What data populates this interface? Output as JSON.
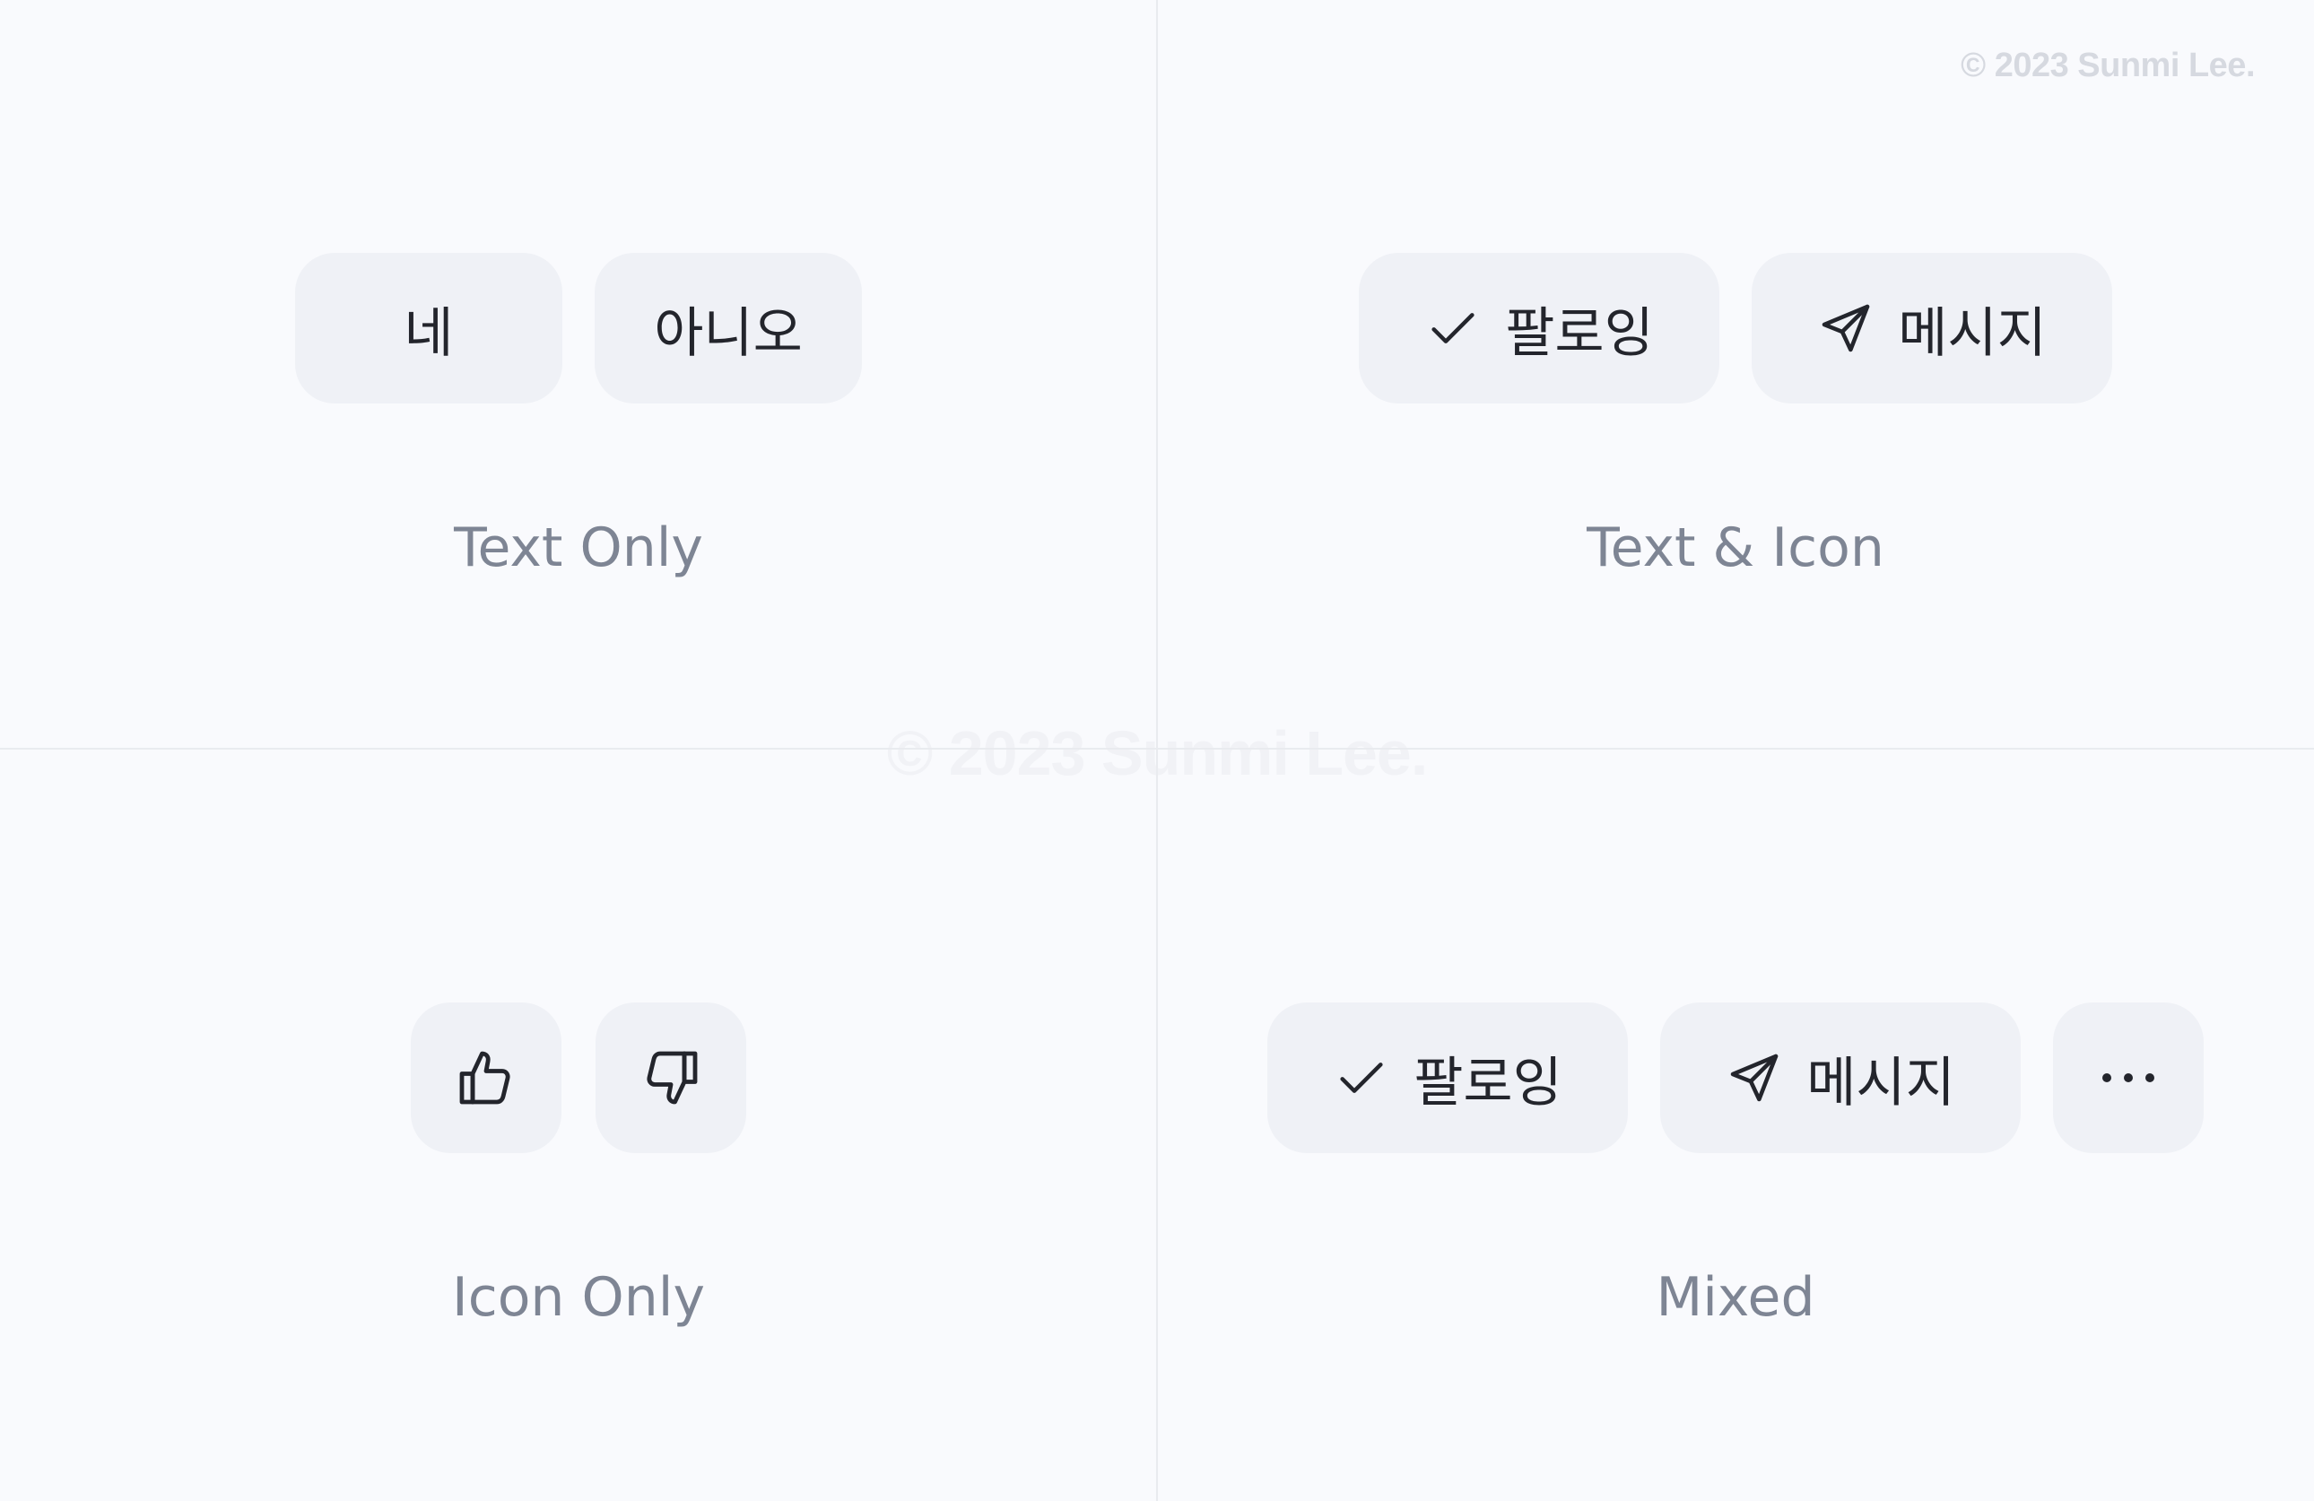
{
  "copyright": "© 2023 Sunmi Lee.",
  "watermark": "© 2023 Sunmi Lee.",
  "sections": {
    "text_only": {
      "label": "Text Only",
      "buttons": [
        "네",
        "아니오"
      ]
    },
    "text_and_icon": {
      "label": "Text & Icon",
      "buttons": [
        {
          "icon": "check-icon",
          "text": "팔로잉"
        },
        {
          "icon": "send-icon",
          "text": "메시지"
        }
      ]
    },
    "icon_only": {
      "label": "Icon Only",
      "buttons": [
        {
          "icon": "thumbs-up-icon"
        },
        {
          "icon": "thumbs-down-icon"
        }
      ]
    },
    "mixed": {
      "label": "Mixed",
      "buttons": [
        {
          "icon": "check-icon",
          "text": "팔로잉"
        },
        {
          "icon": "send-icon",
          "text": "메시지"
        },
        {
          "icon": "more-dots-icon"
        }
      ]
    }
  },
  "colors": {
    "background": "#f9fafd",
    "button_bg": "#eff1f6",
    "button_text": "#23252c",
    "label_text": "#7e8594",
    "divider": "#e9ebef"
  }
}
